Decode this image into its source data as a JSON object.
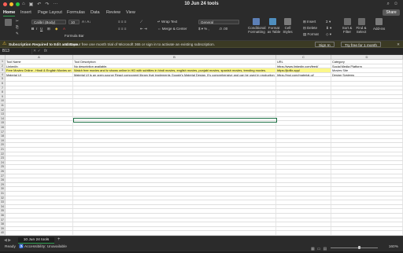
{
  "window": {
    "title": "10 Jun 24 tools"
  },
  "colors": {
    "accent": "#2f9e4f",
    "highlight": "#fbf78a",
    "warning": "#e6b73c"
  },
  "tabs": [
    "Home",
    "Insert",
    "Page Layout",
    "Formulas",
    "Data",
    "Review",
    "View"
  ],
  "share_label": "Share",
  "ribbon": {
    "font_name": "Calibri (Body)",
    "font_size": "10",
    "wrap_text": "Wrap Text",
    "merge_center": "Merge & Center",
    "number_format": "General",
    "conditional_formatting": "Conditional Formatting",
    "format_as_table": "Format as Table",
    "cell_styles": "Cell Styles",
    "insert": "Insert",
    "delete": "Delete",
    "format": "Format",
    "sort_filter": "Sort & Filter",
    "find_select": "Find & Select",
    "add_ins": "Add-ins",
    "formula_bar_label": "Formula Bar"
  },
  "message_bar": {
    "title": "Subscription Required to Edit and Save",
    "text": "Start your free one month trial of Microsoft 365 or sign in to activate an existing subscription.",
    "sign_in": "Sign In",
    "trial": "Try free for 1 month"
  },
  "formula_bar": {
    "name_box": "B13",
    "fx": "fx"
  },
  "columns": [
    "A",
    "B",
    "C",
    "D"
  ],
  "rows": [
    {
      "num": "1",
      "cells": [
        "Tool Name",
        "Tool Description",
        "URL",
        "Category"
      ],
      "highlight": false
    },
    {
      "num": "2",
      "cells": [
        "LinkedIn",
        "No description available.",
        "https://www.linkedin.com/feed/",
        "Social Media Platform"
      ],
      "highlight": false
    },
    {
      "num": "3",
      "cells": [
        "Free Movies Online - Hindi & English Movies on",
        "Watch free movies and tv shows online in HD with subtitles in hindi movies, english movies, punjabi movies, spanish movies, trending movies.",
        "https://jioflix.app/",
        "Movies Site"
      ],
      "highlight": true
    },
    {
      "num": "4",
      "cells": [
        "Material UI",
        "Material UI is an open-source React component library that implements Google's Material Design. It's comprehensive and can be used in production",
        "https://mui.com/material-ui/",
        "Design Systems"
      ],
      "highlight": false
    },
    {
      "num": "5",
      "cells": [
        "",
        "",
        "",
        ""
      ],
      "highlight": false
    },
    {
      "num": "6",
      "cells": [
        "",
        "",
        "",
        ""
      ],
      "highlight": false
    },
    {
      "num": "7",
      "cells": [
        "",
        "",
        "",
        ""
      ],
      "highlight": false
    },
    {
      "num": "8",
      "cells": [
        "",
        "",
        "",
        ""
      ],
      "highlight": false
    },
    {
      "num": "9",
      "cells": [
        "",
        "",
        "",
        ""
      ],
      "highlight": false
    },
    {
      "num": "10",
      "cells": [
        "",
        "",
        "",
        ""
      ],
      "highlight": false
    },
    {
      "num": "11",
      "cells": [
        "",
        "",
        "",
        ""
      ],
      "highlight": false
    },
    {
      "num": "12",
      "cells": [
        "",
        "",
        "",
        ""
      ],
      "highlight": false
    },
    {
      "num": "13",
      "cells": [
        "",
        "",
        "",
        ""
      ],
      "highlight": false
    },
    {
      "num": "14",
      "cells": [
        "",
        "",
        "",
        ""
      ],
      "highlight": false
    },
    {
      "num": "15",
      "cells": [
        "",
        "",
        "",
        ""
      ],
      "highlight": false
    },
    {
      "num": "16",
      "cells": [
        "",
        "",
        "",
        ""
      ],
      "highlight": false
    },
    {
      "num": "17",
      "cells": [
        "",
        "",
        "",
        ""
      ],
      "highlight": false
    },
    {
      "num": "18",
      "cells": [
        "",
        "",
        "",
        ""
      ],
      "highlight": false
    },
    {
      "num": "19",
      "cells": [
        "",
        "",
        "",
        ""
      ],
      "highlight": false
    },
    {
      "num": "20",
      "cells": [
        "",
        "",
        "",
        ""
      ],
      "highlight": false
    },
    {
      "num": "21",
      "cells": [
        "",
        "",
        "",
        ""
      ],
      "highlight": false
    },
    {
      "num": "22",
      "cells": [
        "",
        "",
        "",
        ""
      ],
      "highlight": false
    },
    {
      "num": "23",
      "cells": [
        "",
        "",
        "",
        ""
      ],
      "highlight": false
    },
    {
      "num": "24",
      "cells": [
        "",
        "",
        "",
        ""
      ],
      "highlight": false
    },
    {
      "num": "25",
      "cells": [
        "",
        "",
        "",
        ""
      ],
      "highlight": false
    },
    {
      "num": "26",
      "cells": [
        "",
        "",
        "",
        ""
      ],
      "highlight": false
    },
    {
      "num": "27",
      "cells": [
        "",
        "",
        "",
        ""
      ],
      "highlight": false
    },
    {
      "num": "28",
      "cells": [
        "",
        "",
        "",
        ""
      ],
      "highlight": false
    },
    {
      "num": "29",
      "cells": [
        "",
        "",
        "",
        ""
      ],
      "highlight": false
    },
    {
      "num": "30",
      "cells": [
        "",
        "",
        "",
        ""
      ],
      "highlight": false
    },
    {
      "num": "31",
      "cells": [
        "",
        "",
        "",
        ""
      ],
      "highlight": false
    },
    {
      "num": "32",
      "cells": [
        "",
        "",
        "",
        ""
      ],
      "highlight": false
    },
    {
      "num": "33",
      "cells": [
        "",
        "",
        "",
        ""
      ],
      "highlight": false
    },
    {
      "num": "34",
      "cells": [
        "",
        "",
        "",
        ""
      ],
      "highlight": false
    },
    {
      "num": "35",
      "cells": [
        "",
        "",
        "",
        ""
      ],
      "highlight": false
    },
    {
      "num": "36",
      "cells": [
        "",
        "",
        "",
        ""
      ],
      "highlight": false
    },
    {
      "num": "37",
      "cells": [
        "",
        "",
        "",
        ""
      ],
      "highlight": false
    },
    {
      "num": "38",
      "cells": [
        "",
        "",
        "",
        ""
      ],
      "highlight": false
    },
    {
      "num": "39",
      "cells": [
        "",
        "",
        "",
        ""
      ],
      "highlight": false
    },
    {
      "num": "40",
      "cells": [
        "",
        "",
        "",
        ""
      ],
      "highlight": false
    }
  ],
  "sheet_tab": "10 Jun 24 tools",
  "status": {
    "ready": "Ready",
    "accessibility": "Accessibility: Unavailable",
    "zoom": "160%"
  }
}
